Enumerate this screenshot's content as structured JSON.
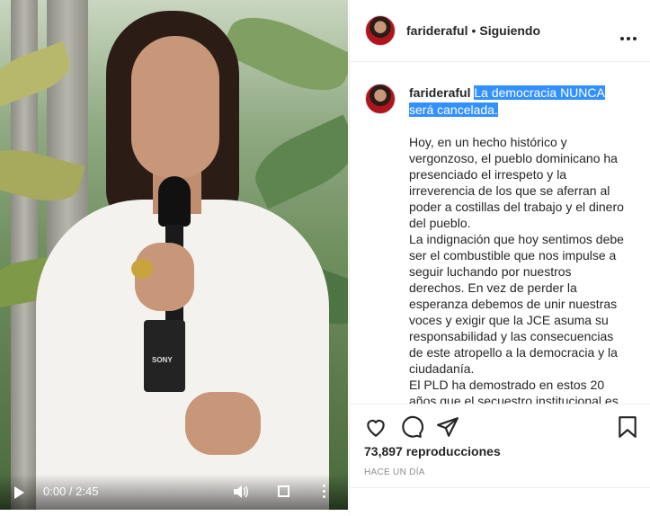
{
  "header": {
    "username": "farideraful",
    "separator": "•",
    "following_label": "Siguiendo"
  },
  "caption": {
    "username": "farideraful",
    "highlighted_text": "La democracia NUNCA será cancelada.",
    "paragraphs": [
      "Hoy, en un hecho histórico y vergonzoso, el pueblo dominicano ha presenciado el irrespeto y la irreverencia de los que se aferran al poder a costillas del trabajo y el dinero del pueblo.",
      "La indignación que hoy sentimos debe ser el combustible que nos impulse a seguir luchando por nuestros derechos. En vez de perder la esperanza debemos de unir nuestras voces y exigir que la JCE asuma su responsabilidad y las consecuencias de este atropello a la democracia y la ciudadanía.",
      "El PLD ha demostrado en estos 20 años que el secuestro institucional es"
    ]
  },
  "video": {
    "time": "0:00 / 2:45",
    "icons": [
      "play-icon",
      "volume-icon",
      "fullscreen-icon",
      "more-vertical-icon"
    ],
    "mic_brand": "SONY"
  },
  "stats": {
    "views": "73,897 reproducciones",
    "date": "HACE UN DÍA"
  },
  "colors": {
    "highlight": "#3390ff",
    "border": "#efefef",
    "text": "#262626",
    "muted": "#8e8e8e"
  }
}
